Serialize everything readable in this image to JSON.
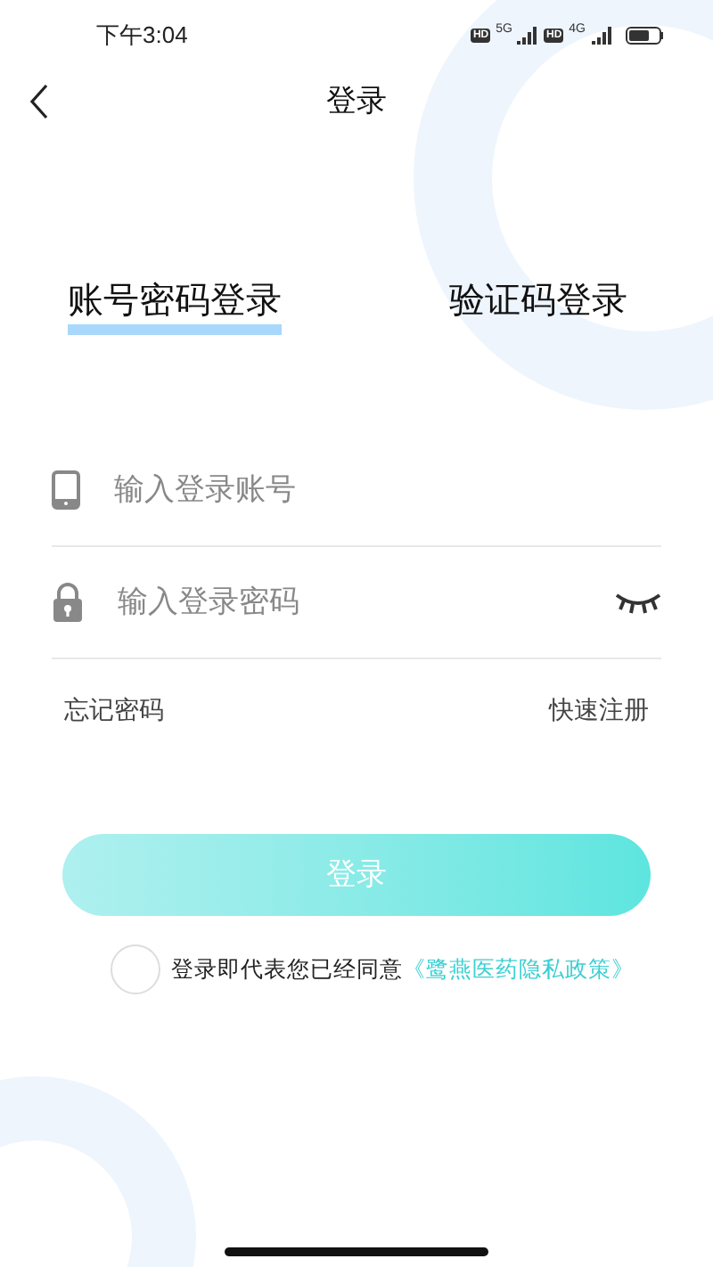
{
  "status_bar": {
    "time": "下午3:04",
    "sim_1": {
      "badge": "HD",
      "network": "5G"
    },
    "sim_2": {
      "badge": "HD",
      "network": "4G"
    }
  },
  "nav": {
    "title": "登录"
  },
  "tabs": [
    {
      "label": "账号密码登录",
      "selected": true
    },
    {
      "label": "验证码登录",
      "selected": false
    }
  ],
  "fields": [
    {
      "kind": "account",
      "placeholder": "输入登录账号"
    },
    {
      "kind": "password",
      "placeholder": "输入登录密码",
      "password_visible": false
    }
  ],
  "links": {
    "forgot": "忘记密码",
    "register": "快速注册"
  },
  "login_button": "登录",
  "agreement": {
    "checked": false,
    "text": "登录即代表您已经同意",
    "link": "《鹭燕医药隐私政策》"
  }
}
